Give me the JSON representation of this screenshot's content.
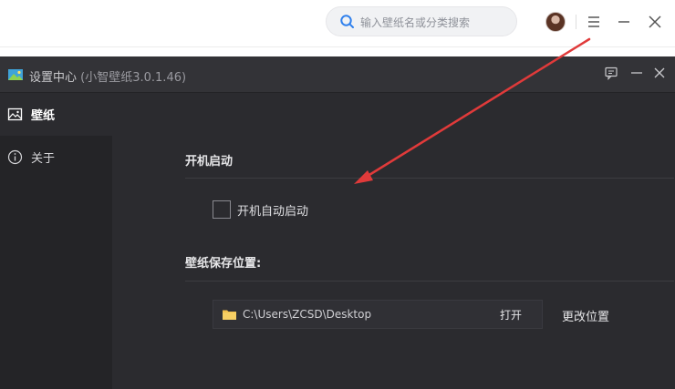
{
  "top_bar": {
    "search_placeholder": "输入壁纸名或分类搜索",
    "icons": [
      "search-icon",
      "avatar",
      "menu-icon",
      "minimize-icon",
      "close-icon"
    ]
  },
  "dialog": {
    "title": "设置中心",
    "version": "(小智壁纸3.0.1.46)",
    "title_icons": [
      "feedback-icon",
      "minimize-icon",
      "close-icon"
    ]
  },
  "sidebar": {
    "items": [
      {
        "label": "壁纸",
        "icon": "image-icon",
        "active": true
      },
      {
        "label": "关于",
        "icon": "info-icon",
        "active": false
      }
    ]
  },
  "content": {
    "startup": {
      "heading": "开机启动",
      "checkbox_label": "开机自动启动",
      "checked": false
    },
    "save_location": {
      "heading": "壁纸保存位置:",
      "path": "C:\\Users\\ZCSD\\Desktop",
      "open_label": "打开",
      "change_label": "更改位置"
    }
  },
  "colors": {
    "dialog_bg": "#2b2b2f",
    "sidebar_bg": "#242427",
    "arrow": "#e03a3a",
    "folder": "#f2c14e"
  }
}
